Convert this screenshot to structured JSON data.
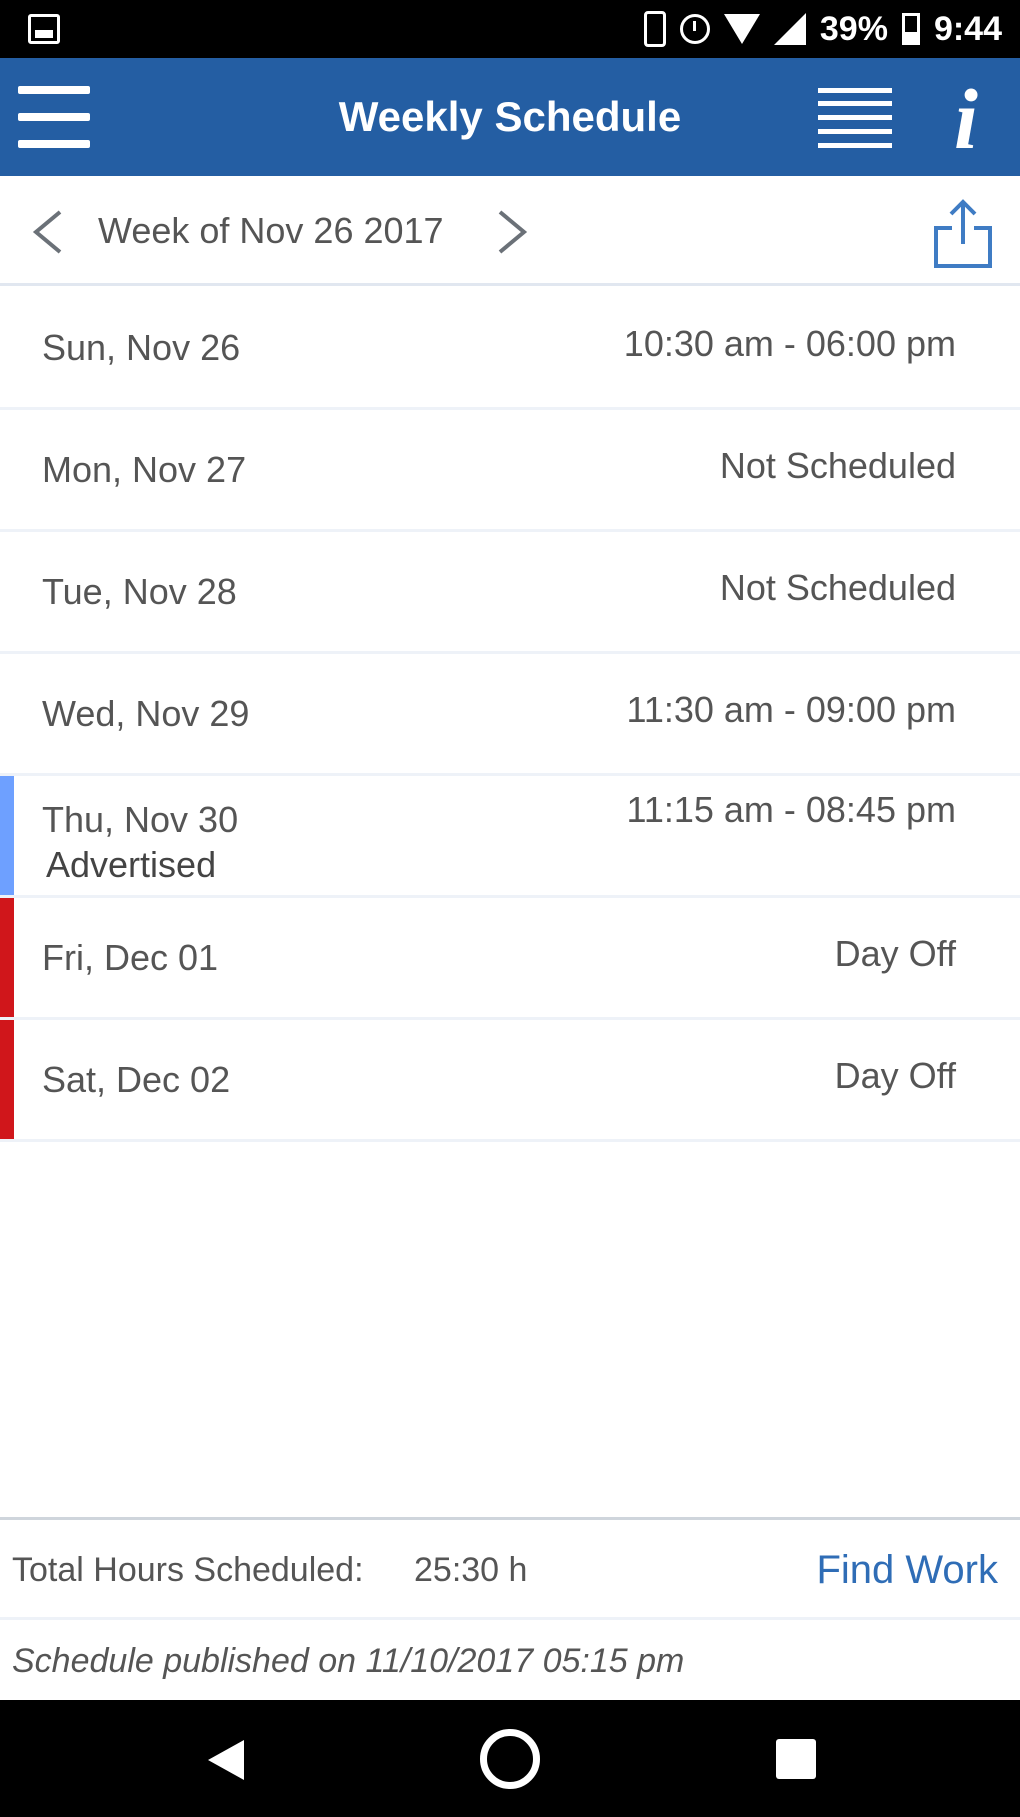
{
  "status_bar": {
    "battery_percent": "39%",
    "time": "9:44",
    "icons": [
      "notification-image-icon",
      "phone-icon",
      "alarm-icon",
      "wifi-icon",
      "signal-icon",
      "battery-icon"
    ]
  },
  "app_bar": {
    "title": "Weekly Schedule",
    "icons": [
      "menu-icon",
      "list-view-icon",
      "info-icon"
    ],
    "background_color": "#245ea3"
  },
  "week_nav": {
    "label": "Week of Nov 26 2017",
    "icons": [
      "chevron-left-icon",
      "chevron-right-icon",
      "share-icon"
    ]
  },
  "schedule": {
    "days": [
      {
        "date": "Sun, Nov 26",
        "time": "10:30 am - 06:00 pm",
        "note": "",
        "marker": ""
      },
      {
        "date": "Mon, Nov 27",
        "time": "Not Scheduled",
        "note": "",
        "marker": ""
      },
      {
        "date": "Tue, Nov 28",
        "time": "Not Scheduled",
        "note": "",
        "marker": ""
      },
      {
        "date": "Wed, Nov 29",
        "time": "11:30 am - 09:00 pm",
        "note": "",
        "marker": ""
      },
      {
        "date": "Thu, Nov 30",
        "time": "11:15 am - 08:45 pm",
        "note": "Advertised",
        "marker": "#6ea0ff"
      },
      {
        "date": "Fri, Dec 01",
        "time": "Day Off",
        "note": "",
        "marker": "#d0161b"
      },
      {
        "date": "Sat, Dec 02",
        "time": "Day Off",
        "note": "",
        "marker": "#d0161b"
      }
    ]
  },
  "footer": {
    "total_label": "Total Hours Scheduled:",
    "total_value": "25:30 h",
    "find_work": "Find Work",
    "published": "Schedule published on 11/10/2017 05:15 pm",
    "link_color": "#2f6db6"
  },
  "nav_bar": {
    "icons": [
      "back-icon",
      "home-icon",
      "recents-icon"
    ]
  }
}
